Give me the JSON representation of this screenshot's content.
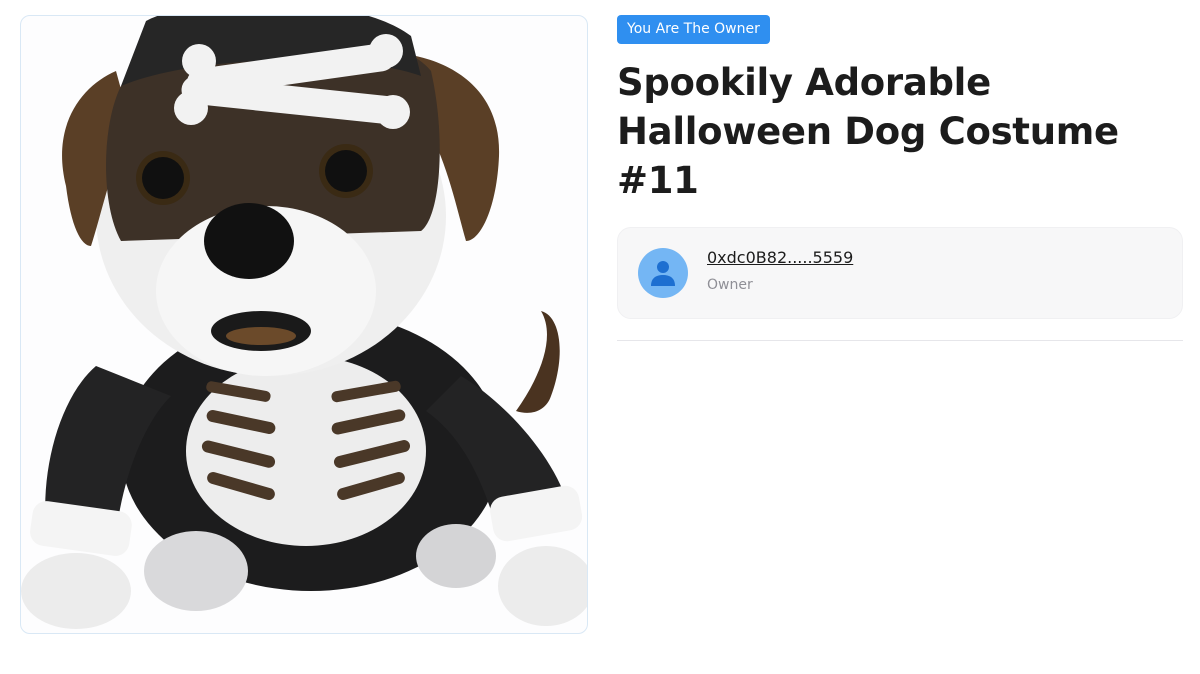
{
  "badge": {
    "label": "You Are The Owner",
    "color": "#2f8ff0"
  },
  "nft": {
    "title": "Spookily Adorable Halloween Dog Costume #11",
    "image_subject": "toy dog wearing a skeleton halloween costume"
  },
  "owner": {
    "address": "0xdc0B82.....5559",
    "role_label": "Owner",
    "avatar_icon": "user-icon",
    "avatar_color": "#74b6f4"
  }
}
